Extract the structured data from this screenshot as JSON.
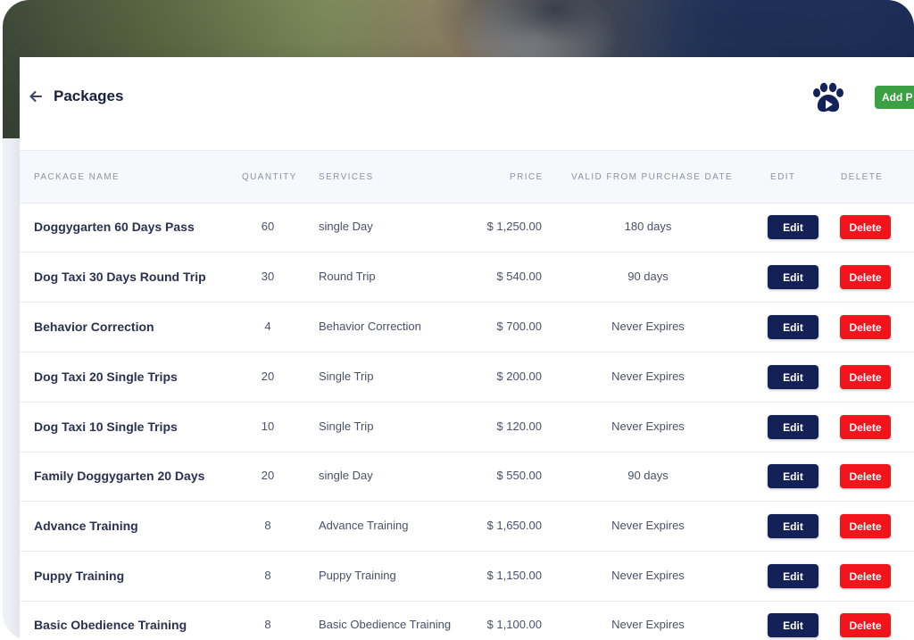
{
  "header": {
    "title": "Packages",
    "add_button_label": "Add P"
  },
  "table": {
    "columns": {
      "package_name": "PACKAGE NAME",
      "quantity": "QUANTITY",
      "services": "SERVICES",
      "price": "PRICE",
      "valid": "VALID FROM PURCHASE DATE",
      "edit": "EDIT",
      "delete": "DELETE"
    },
    "edit_label": "Edit",
    "delete_label": "Delete",
    "rows": [
      {
        "name": "Doggygarten 60 Days Pass",
        "quantity": "60",
        "services": "single Day",
        "price": "$ 1,250.00",
        "valid": "180 days"
      },
      {
        "name": "Dog Taxi 30 Days Round Trip",
        "quantity": "30",
        "services": "Round Trip",
        "price": "$ 540.00",
        "valid": "90 days"
      },
      {
        "name": "Behavior Correction",
        "quantity": "4",
        "services": "Behavior Correction",
        "price": "$ 700.00",
        "valid": "Never Expires"
      },
      {
        "name": "Dog Taxi 20 Single Trips",
        "quantity": "20",
        "services": "Single Trip",
        "price": "$ 200.00",
        "valid": "Never Expires"
      },
      {
        "name": "Dog Taxi 10 Single Trips",
        "quantity": "10",
        "services": "Single Trip",
        "price": "$ 120.00",
        "valid": "Never Expires"
      },
      {
        "name": "Family Doggygarten 20 Days",
        "quantity": "20",
        "services": "single Day",
        "price": "$ 550.00",
        "valid": "90 days"
      },
      {
        "name": "Advance Training",
        "quantity": "8",
        "services": "Advance Training",
        "price": "$ 1,650.00",
        "valid": "Never Expires"
      },
      {
        "name": "Puppy Training",
        "quantity": "8",
        "services": "Puppy Training",
        "price": "$ 1,150.00",
        "valid": "Never Expires"
      },
      {
        "name": "Basic Obedience Training",
        "quantity": "8",
        "services": "Basic Obedience Training",
        "price": "$ 1,100.00",
        "valid": "Never Expires"
      }
    ]
  },
  "icons": {
    "back": "arrow-left-icon",
    "paw": "paw-play-icon"
  },
  "colors": {
    "edit_button": "#142156",
    "delete_button": "#f2141b",
    "add_button": "#3aa043",
    "title": "#1a2140"
  }
}
